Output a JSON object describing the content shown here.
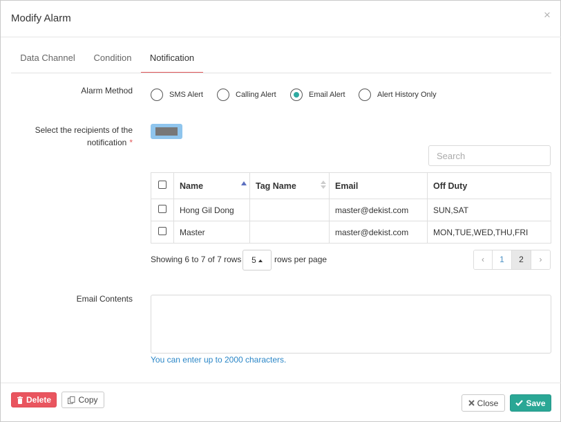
{
  "modal": {
    "title": "Modify Alarm",
    "close_glyph": "×"
  },
  "tabs": [
    {
      "label": "Data Channel",
      "active": false
    },
    {
      "label": "Condition",
      "active": false
    },
    {
      "label": "Notification",
      "active": true
    }
  ],
  "alarm_method": {
    "label": "Alarm Method",
    "options": [
      {
        "label": "SMS Alert",
        "checked": false
      },
      {
        "label": "Calling Alert",
        "checked": false
      },
      {
        "label": "Email Alert",
        "checked": true
      },
      {
        "label": "Alert History Only",
        "checked": false
      }
    ]
  },
  "recipients": {
    "label_line1": "Select the recipients of the",
    "label_line2": "notification",
    "required_mark": "*"
  },
  "search": {
    "placeholder": "Search",
    "value": ""
  },
  "table": {
    "columns": [
      "Name",
      "Tag Name",
      "Email",
      "Off Duty"
    ],
    "rows": [
      {
        "name": "Hong Gil Dong",
        "tag_name": "",
        "email": "master@dekist.com",
        "off_duty": "SUN,SAT"
      },
      {
        "name": "Master",
        "tag_name": "",
        "email": "master@dekist.com",
        "off_duty": "MON,TUE,WED,THU,FRI"
      }
    ]
  },
  "pagination": {
    "showing": "Showing 6 to 7 of 7 rows",
    "page_size": "5",
    "rows_per_page": "rows per page",
    "prev": "‹",
    "pages": [
      "1",
      "2"
    ],
    "current_page": "2",
    "next": "›"
  },
  "email_contents": {
    "label": "Email Contents",
    "value": "",
    "hint": "You can enter up to 2000 characters."
  },
  "footer": {
    "delete_label": "Delete",
    "copy_label": "Copy",
    "close_label": "Close",
    "save_label": "Save"
  },
  "colors": {
    "accent_tab": "#e2585a",
    "radio_checked": "#2eaaa1",
    "delete_button": "#e9555f",
    "save_button": "#2aa795",
    "hint_text": "#2a86c7",
    "chip": "#8fc5ed"
  },
  "icons": {
    "close": "close-icon",
    "delete": "trash-icon",
    "copy": "copy-icon",
    "close_button": "times-icon",
    "save": "check-icon",
    "sort_asc": "sort-asc-icon",
    "sort_both": "sort-icon"
  }
}
